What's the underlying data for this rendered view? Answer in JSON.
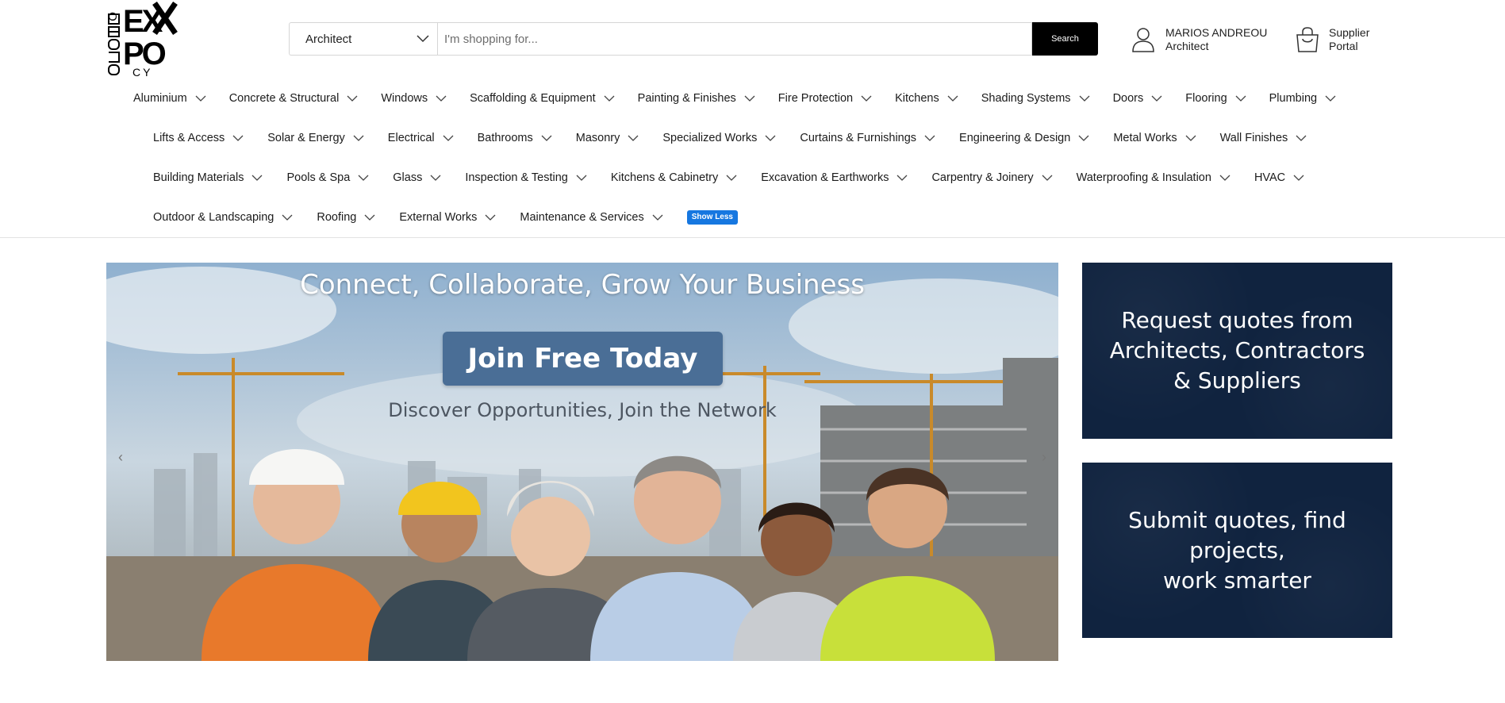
{
  "logo": {
    "lettering": "OMO EXPO DO CY"
  },
  "search": {
    "role_selected": "Architect",
    "placeholder": "I'm shopping for...",
    "button_label": "Search"
  },
  "account": {
    "name": "MARIOS ANDREOU",
    "role": "Architect"
  },
  "supplier": {
    "line1": "Supplier",
    "line2": "Portal"
  },
  "categories": {
    "row1": [
      "Aluminium",
      "Concrete & Structural",
      "Windows",
      "Scaffolding & Equipment",
      "Painting & Finishes",
      "Fire Protection",
      "Kitchens",
      "Shading Systems",
      "Doors",
      "Flooring",
      "Plumbing"
    ],
    "row2": [
      "Lifts & Access",
      "Solar & Energy",
      "Electrical",
      "Bathrooms",
      "Masonry",
      "Specialized Works",
      "Curtains & Furnishings",
      "Engineering & Design",
      "Metal Works",
      "Wall Finishes"
    ],
    "row3": [
      "Building Materials",
      "Pools & Spa",
      "Glass",
      "Inspection & Testing",
      "Kitchens & Cabinetry",
      "Excavation & Earthworks",
      "Carpentry & Joinery",
      "Waterproofing & Insulation",
      "HVAC"
    ],
    "row4": [
      "Outdoor & Landscaping",
      "Roofing",
      "External Works",
      "Maintenance & Services"
    ],
    "toggle_label": "Show Less"
  },
  "hero": {
    "headline": "Connect, Collaborate, Grow Your Business",
    "button_label": "Join Free Today",
    "subline": "Discover Opportunities, Join the Network",
    "prev_arrow": "‹",
    "next_arrow": "›"
  },
  "cards": {
    "card1_lines": [
      "Request quotes from",
      "Architects, Contractors",
      "& Suppliers"
    ],
    "card2_lines": [
      "Submit quotes, find projects,",
      "work smarter"
    ]
  },
  "colors": {
    "accent": "#1677e0",
    "card_bg": "#10233f",
    "join_button": "#4a6e96",
    "search_button": "#000000"
  }
}
